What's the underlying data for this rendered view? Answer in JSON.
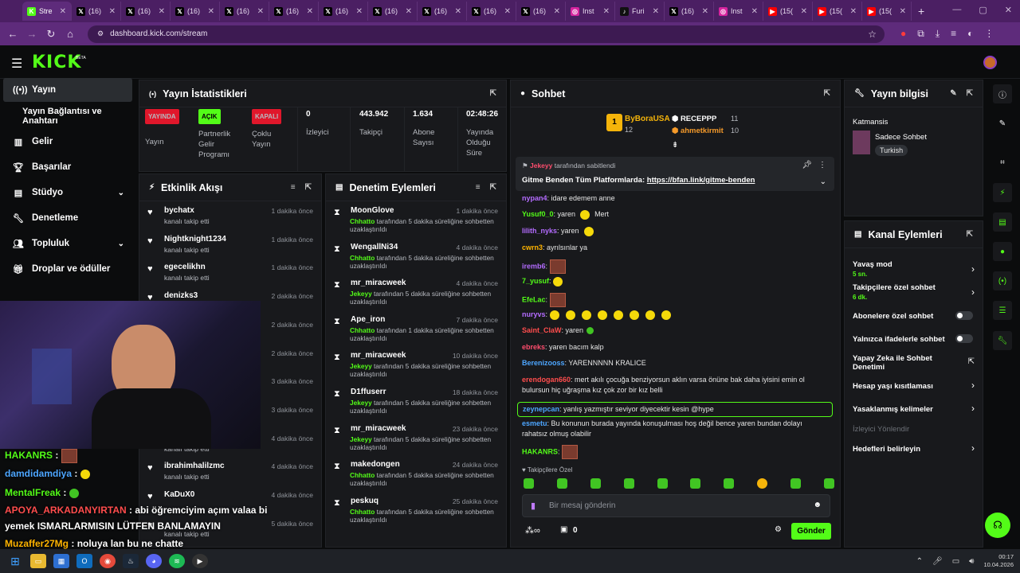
{
  "browser": {
    "tabs": [
      {
        "label": "Stre",
        "icon": "kick-icon",
        "color": "#53fc18"
      },
      {
        "label": "(16)",
        "icon": "x-icon",
        "color": "#000000"
      },
      {
        "label": "(16)",
        "icon": "x-icon",
        "color": "#000000"
      },
      {
        "label": "(16)",
        "icon": "x-icon",
        "color": "#000000"
      },
      {
        "label": "(16)",
        "icon": "x-icon",
        "color": "#000000"
      },
      {
        "label": "(16)",
        "icon": "x-icon",
        "color": "#000000"
      },
      {
        "label": "(16)",
        "icon": "x-icon",
        "color": "#000000"
      },
      {
        "label": "(16)",
        "icon": "x-icon",
        "color": "#000000"
      },
      {
        "label": "(16)",
        "icon": "x-icon",
        "color": "#000000"
      },
      {
        "label": "(16)",
        "icon": "x-icon",
        "color": "#000000"
      },
      {
        "label": "(16)",
        "icon": "x-icon",
        "color": "#000000"
      },
      {
        "label": "Inst",
        "icon": "instagram-icon",
        "color": "#d6249f"
      },
      {
        "label": "Furi",
        "icon": "tiktok-icon",
        "color": "#111111"
      },
      {
        "label": "(16)",
        "icon": "x-icon",
        "color": "#000000"
      },
      {
        "label": "Inst",
        "icon": "instagram-icon",
        "color": "#d6249f"
      },
      {
        "label": "(15(",
        "icon": "youtube-icon",
        "color": "#ff0000"
      },
      {
        "label": "(15(",
        "icon": "youtube-icon",
        "color": "#ff0000"
      },
      {
        "label": "(15(",
        "icon": "youtube-icon",
        "color": "#ff0000"
      }
    ],
    "url": "dashboard.kick.com/stream"
  },
  "sidebar": {
    "items": [
      {
        "label": "Yayın",
        "icon": "broadcast-icon"
      },
      {
        "label": "Yayın Bağlantısı ve Anahtarı"
      },
      {
        "label": "Gelir",
        "icon": "chart-icon"
      },
      {
        "label": "Başarılar",
        "icon": "trophy-icon"
      },
      {
        "label": "Stüdyo",
        "icon": "studio-icon"
      },
      {
        "label": "Denetleme",
        "icon": "wrench-icon"
      },
      {
        "label": "Topluluk",
        "icon": "community-icon"
      },
      {
        "label": "Droplar ve ödüller",
        "icon": "gift-icon"
      }
    ]
  },
  "stats": {
    "title": "Yayın İstatistikleri",
    "live_badge": "YAYINDA",
    "live_label": "Yayın",
    "partner_badge": "AÇIK",
    "partner_label": "Partnerlik Gelir Programı",
    "multi_badge": "KAPALI",
    "multi_label": "Çoklu Yayın",
    "viewers_value": "0",
    "viewers_label": "İzleyici",
    "followers_value": "443.942",
    "followers_label": "Takipçi",
    "subs_value": "1.634",
    "subs_label": "Abone Sayısı",
    "uptime_value": "02:48:26",
    "uptime_label": "Yayında Olduğu Süre"
  },
  "activity": {
    "title": "Etkinlik Akışı",
    "rows": [
      {
        "name": "bychatx",
        "sub": "kanalı takip etti",
        "time": "1 dakika önce"
      },
      {
        "name": "Nightknight1234",
        "sub": "kanalı takip etti",
        "time": "1 dakika önce"
      },
      {
        "name": "egecelikhn",
        "sub": "kanalı takip etti",
        "time": "1 dakika önce"
      },
      {
        "name": "denizks3",
        "sub": "kanalı takip etti",
        "time": "2 dakika önce"
      },
      {
        "name": "",
        "sub": "",
        "time": "2 dakika önce"
      },
      {
        "name": "",
        "sub": "",
        "time": "2 dakika önce"
      },
      {
        "name": "",
        "sub": "",
        "time": "3 dakika önce"
      },
      {
        "name": "",
        "sub": "",
        "time": "3 dakika önce"
      },
      {
        "name": "",
        "sub": "kanalı takip etti",
        "time": "4 dakika önce"
      },
      {
        "name": "ibrahimhalilzmc",
        "sub": "kanalı takip etti",
        "time": "4 dakika önce"
      },
      {
        "name": "KaDuX0",
        "sub": "",
        "time": "4 dakika önce"
      },
      {
        "name": "",
        "sub": "kanalı takip etti",
        "time": "5 dakika önce"
      }
    ]
  },
  "moderation": {
    "title": "Denetim Eylemleri",
    "rows": [
      {
        "name": "MoonGlove",
        "mod": "Chhatto",
        "text": "tarafından 5 dakika süreliğine sohbetten uzaklaştırıldı",
        "time": "1 dakika önce"
      },
      {
        "name": "WengallNi34",
        "mod": "Chhatto",
        "text": "tarafından 5 dakika süreliğine sohbetten uzaklaştırıldı",
        "time": "4 dakika önce"
      },
      {
        "name": "mr_miracweek",
        "mod": "Jekeyy",
        "text": "tarafından 5 dakika süreliğine sohbetten uzaklaştırıldı",
        "time": "4 dakika önce"
      },
      {
        "name": "Ape_iron",
        "mod": "Chhatto",
        "text": "tarafından 1 dakika süreliğine sohbetten uzaklaştırıldı",
        "time": "7 dakika önce"
      },
      {
        "name": "mr_miracweek",
        "mod": "Jekeyy",
        "text": "tarafından 5 dakika süreliğine sohbetten uzaklaştırıldı",
        "time": "10 dakika önce"
      },
      {
        "name": "D1ffuserr",
        "mod": "Jekeyy",
        "text": "tarafından 5 dakika süreliğine sohbetten uzaklaştırıldı",
        "time": "18 dakika önce"
      },
      {
        "name": "mr_miracweek",
        "mod": "Jekeyy",
        "text": "tarafından 5 dakika süreliğine sohbetten uzaklaştırıldı",
        "time": "23 dakika önce"
      },
      {
        "name": "makedongen",
        "mod": "Chhatto",
        "text": "tarafından 5 dakika süreliğine sohbetten uzaklaştırıldı",
        "time": "24 dakika önce"
      },
      {
        "name": "peskuq",
        "mod": "Chhatto",
        "text": "tarafından 5 dakika süreliğine sohbetten uzaklaştırıldı",
        "time": "25 dakika önce"
      }
    ]
  },
  "chat": {
    "title": "Sohbet",
    "top1_name": "ByBoraUSA",
    "top1_count": "12",
    "top2_name": "RECEPPP",
    "top2_count": "11",
    "top3_name": "ahmetkirmit",
    "top3_count": "10",
    "pinned_by": "Jekeyy",
    "pinned_by_suffix": "tarafından sabitlendi",
    "pinned_text": "Gitme Benden Tüm Platformlarda:",
    "pinned_link": "https://bfan.link/gitme-benden",
    "messages": [
      {
        "user": "nypan4",
        "color": "#b46cff",
        "text": "idare edemem anne"
      },
      {
        "user": "Yusuf0_0",
        "color": "#53fc18",
        "text": "yaren",
        "emote": "Mert"
      },
      {
        "user": "lilith_nyks",
        "color": "#b46cff",
        "text": "yaren"
      },
      {
        "user": "cwrn3",
        "color": "#ffb400",
        "text": "ayrılsınlar ya"
      },
      {
        "user": "iremb6",
        "color": "#b46cff",
        "text": ""
      },
      {
        "user": "7_yusuf",
        "color": "#53fc18",
        "text": ""
      },
      {
        "user": "EfeLac",
        "color": "#53fc18",
        "text": ""
      },
      {
        "user": "nuryvs",
        "color": "#b46cff",
        "text": ""
      },
      {
        "user": "Saint_ClaW",
        "color": "#ff4d4d",
        "text": "yaren"
      },
      {
        "user": "ebreks",
        "color": "#ff4d6d",
        "text": "yaren bacım kalp"
      },
      {
        "user": "Berenizooss",
        "color": "#4da6ff",
        "text": "YARENNNNN KRALICE"
      },
      {
        "user": "erendogan660",
        "color": "#ff4d4d",
        "text": "mert akılı çocuğa benziyorsun aklın varsa önüne bak daha iyisini emin ol bulursun hiç uğraşma kız çok zor bir kız belli"
      },
      {
        "user": "zeynepcan",
        "color": "#4da6ff",
        "text": "yanlış yazmıştır seviyor diyecektir kesin @hype"
      },
      {
        "user": "esmetu",
        "color": "#4da6ff",
        "text": "Bu konunun burada yayında konuşulması hoş değil bence yaren bundan dolayı rahatsız olmuş olabilir"
      },
      {
        "user": "HAKANRS",
        "color": "#53fc18",
        "text": ""
      }
    ],
    "followers_only": "Takipçilere Özel",
    "input_placeholder": "Bir mesaj gönderin",
    "points": "0",
    "send_label": "Gönder"
  },
  "stream_info": {
    "title": "Yayın bilgisi",
    "category": "Katmansis",
    "stream_title": "Sadece Sohbet",
    "tag": "Turkish"
  },
  "channel_actions": {
    "title": "Kanal Eylemleri",
    "slow_mode": "Yavaş mod",
    "slow_mode_value": "5 sn.",
    "followers_chat": "Takipçilere özel sohbet",
    "followers_chat_value": "6 dk.",
    "subs_chat": "Abonelere özel sohbet",
    "emote_chat": "Yalnızca ifadelerle sohbet",
    "ai_mod": "Yapay Zeka ile Sohbet Denetimi",
    "age_limit": "Hesap yaşı kısıtlaması",
    "banned_words": "Yasaklanmış kelimeler",
    "raid": "İzleyici Yönlendir",
    "goals": "Hedefleri belirleyin"
  },
  "overlay": {
    "messages": [
      {
        "user": "HAKANRS",
        "color": "#53fc18",
        "text": ""
      },
      {
        "user": "damdidamdiya",
        "color": "#4da6ff",
        "text": ""
      },
      {
        "user": "MentalFreak",
        "color": "#53fc18",
        "text": ""
      },
      {
        "user": "APOYA_ARKADANYIRTAN",
        "color": "#ff4d4d",
        "text": "abi öğremciyim açım valaa bi"
      },
      {
        "user": "",
        "color": "#ffffff",
        "text": "yemek ISMARLARMISIN LÜTFEN BANLAMAYIN"
      },
      {
        "user": "Muzaffer27Mg",
        "color": "#ffb400",
        "text": "noluya lan bu ne chatte"
      }
    ]
  },
  "taskbar": {
    "time": "00:17",
    "date": "10.04.2026"
  },
  "colors": {
    "brand": "#53fc18",
    "panel": "#18191c",
    "tabbar": "#4b1f63",
    "addressbar": "#5e2b7b"
  }
}
